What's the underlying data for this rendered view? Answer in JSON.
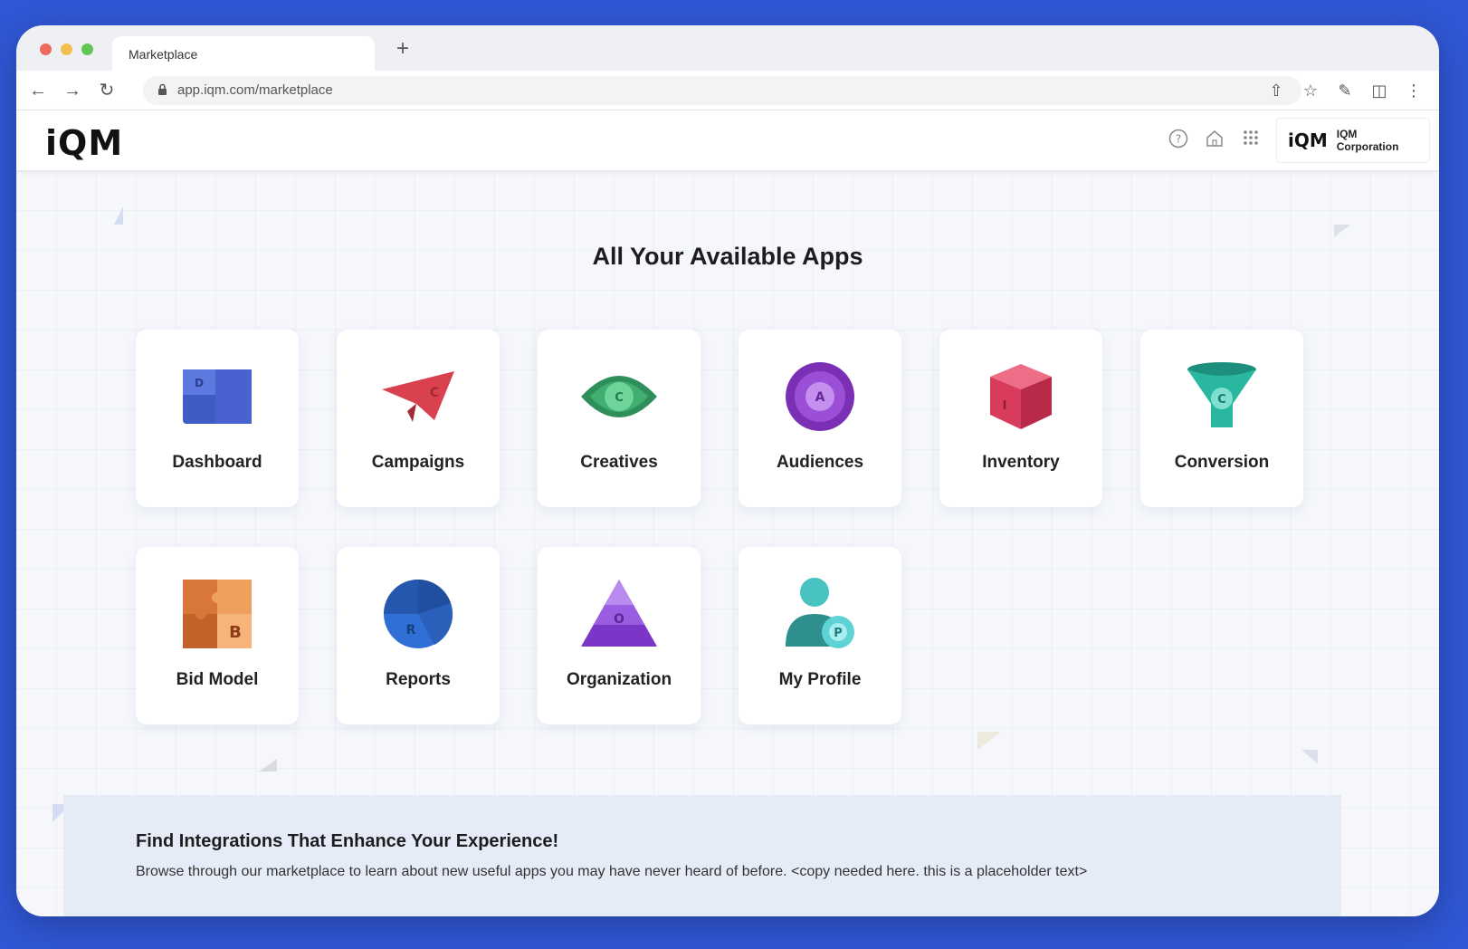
{
  "browser": {
    "tab_title": "Marketplace",
    "new_tab_symbol": "+",
    "url": "app.iqm.com/marketplace"
  },
  "header": {
    "logo": "iQM",
    "org_logo": "iQM",
    "org_name": "IQM Corporation"
  },
  "main": {
    "title": "All Your Available Apps",
    "apps": [
      {
        "label": "Dashboard",
        "letter": "D"
      },
      {
        "label": "Campaigns",
        "letter": "C"
      },
      {
        "label": "Creatives",
        "letter": "C"
      },
      {
        "label": "Audiences",
        "letter": "A"
      },
      {
        "label": "Inventory",
        "letter": "I"
      },
      {
        "label": "Conversion",
        "letter": "C"
      },
      {
        "label": "Bid Model",
        "letter": "B"
      },
      {
        "label": "Reports",
        "letter": "R"
      },
      {
        "label": "Organization",
        "letter": "O"
      },
      {
        "label": "My Profile",
        "letter": "P"
      }
    ]
  },
  "promo": {
    "title": "Find Integrations That Enhance Your Experience!",
    "text": "Browse through our marketplace to learn about new useful apps you may have never heard of before.  <copy needed here. this is a placeholder text>"
  },
  "colors": {
    "page_background": "#3057d5",
    "dashboard": "#3f5bc4",
    "campaigns": "#d9414e",
    "creatives": "#2f8f5b",
    "audiences": "#7a2fb5",
    "inventory": "#d83b5c",
    "conversion": "#2ab7a0",
    "bid_model": "#d9773a",
    "reports": "#2f6fd6",
    "organization": "#7b36c7",
    "my_profile": "#49c3c1"
  },
  "icons": [
    "back-arrow-icon",
    "forward-arrow-icon",
    "reload-icon",
    "lock-icon",
    "share-icon",
    "star-icon",
    "extensions-icon",
    "sidebar-icon",
    "more-icon",
    "help-icon",
    "home-icon",
    "apps-grid-icon"
  ]
}
